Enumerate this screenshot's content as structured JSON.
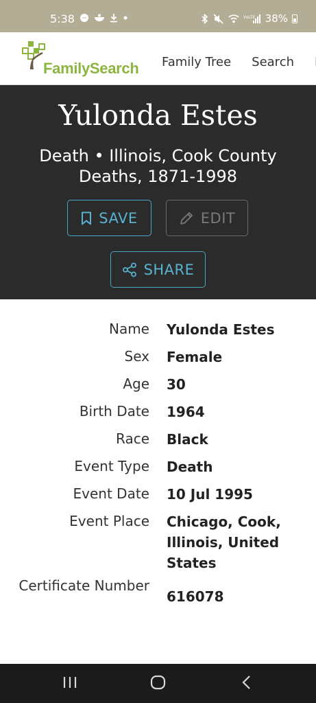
{
  "status_bar": {
    "time": "5:38",
    "battery": "38%"
  },
  "app_header": {
    "logo_text": "FamilySearch",
    "nav": [
      "Family Tree",
      "Search",
      "M"
    ]
  },
  "hero": {
    "title": "Yulonda Estes",
    "subtitle": "Death • Illinois, Cook County Deaths, 1871-1998",
    "save_label": "SAVE",
    "edit_label": "EDIT",
    "share_label": "SHARE"
  },
  "details": [
    {
      "label": "Name",
      "value": "Yulonda Estes"
    },
    {
      "label": "Sex",
      "value": "Female"
    },
    {
      "label": "Age",
      "value": "30"
    },
    {
      "label": "Birth Date",
      "value": "1964"
    },
    {
      "label": "Race",
      "value": "Black"
    },
    {
      "label": "Event Type",
      "value": "Death"
    },
    {
      "label": "Event Date",
      "value": "10 Jul 1995"
    },
    {
      "label": "Event Place",
      "value": "Chicago, Cook, Illinois, United States"
    },
    {
      "label": "Certificate Number",
      "value": "616078"
    }
  ],
  "colors": {
    "status_bar": "#b4ad96",
    "hero_bg": "#2b2b2b",
    "accent": "#4ba9c7",
    "logo_green": "#8cb53f"
  }
}
